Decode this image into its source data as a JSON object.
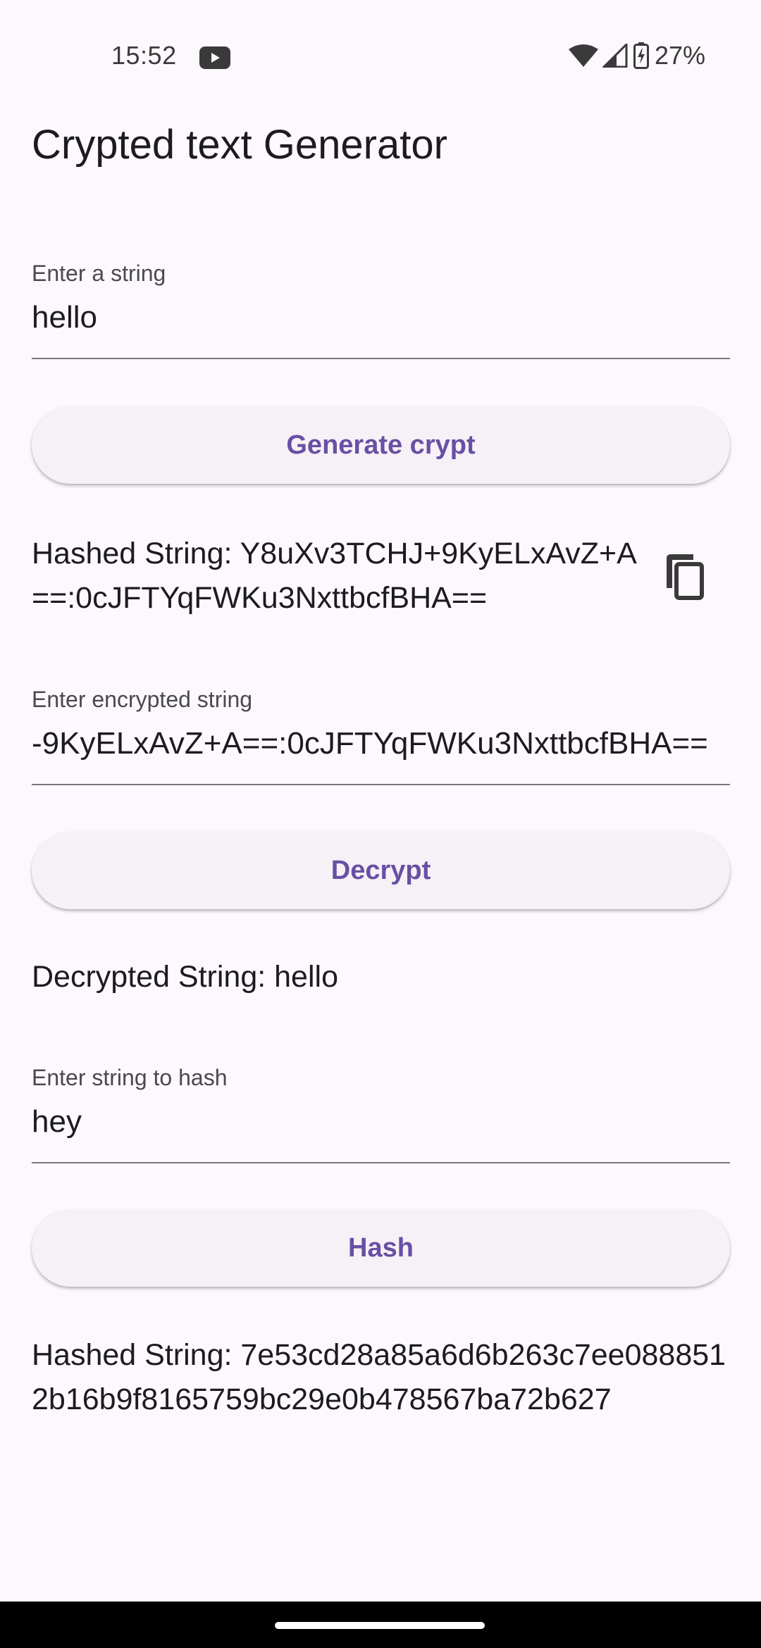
{
  "status_bar": {
    "time": "15:52",
    "battery": "27%",
    "icons": [
      "youtube-icon",
      "wifi-icon",
      "signal-icon",
      "battery-charging-icon"
    ]
  },
  "app": {
    "title": "Crypted text Generator"
  },
  "encrypt_section": {
    "input_label": "Enter a string",
    "input_value": "hello",
    "button_label": "Generate crypt",
    "result_text": "Hashed String: Y8uXv3TCHJ+9KyELxAvZ+A==:0cJFTYqFWKu3NxttbcfBHA==",
    "copy_icon": "copy-icon"
  },
  "decrypt_section": {
    "input_label": "Enter encrypted string",
    "input_value": "-9KyELxAvZ+A==:0cJFTYqFWKu3NxttbcfBHA==",
    "button_label": "Decrypt",
    "result_text": "Decrypted String: hello"
  },
  "hash_section": {
    "input_label": "Enter string to hash",
    "input_value": "hey",
    "button_label": "Hash",
    "result_text": "Hashed String: 7e53cd28a85a6d6b263c7ee0888512b16b9f8165759bc29e0b478567ba72b627"
  },
  "colors": {
    "background": "#fdf8fd",
    "accent": "#6750a4",
    "button_surface": "#f6f1f6",
    "nav_bar": "#000000"
  }
}
